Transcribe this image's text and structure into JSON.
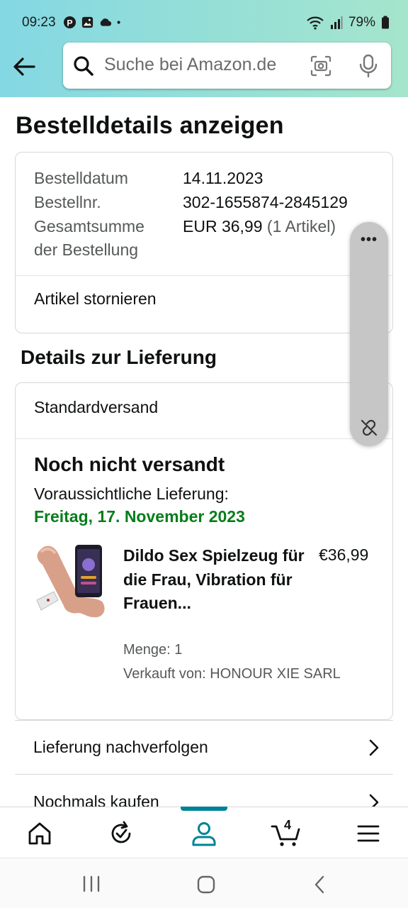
{
  "status_bar": {
    "time": "09:23",
    "battery": "79%"
  },
  "search": {
    "placeholder": "Suche bei Amazon.de"
  },
  "page_title": "Bestelldetails anzeigen",
  "order": {
    "date_label": "Bestelldatum",
    "date_value": "14.11.2023",
    "number_label": "Bestellnr.",
    "number_value": "302-1655874-2845129",
    "total_label_1": "Gesamtsumme",
    "total_label_2": "der Bestellung",
    "total_value": "EUR 36,99",
    "total_items": "(1 Artikel)",
    "cancel_label": "Artikel stornieren"
  },
  "delivery": {
    "section_title": "Details zur Lieferung",
    "method": "Standardversand",
    "status": "Noch nicht versandt",
    "estimate_label": "Voraussichtliche Lieferung:",
    "estimate_date": "Freitag, 17. November 2023",
    "item": {
      "title": "Dildo Sex Spielzeug für die Frau, Vibration für Frauen...",
      "price": "€36,99",
      "quantity": "Menge: 1",
      "seller": "Verkauft von: HONOUR XIE SARL"
    }
  },
  "actions": [
    {
      "label": "Lieferung nachverfolgen"
    },
    {
      "label": "Nochmals kaufen"
    }
  ],
  "bottom_nav": {
    "cart_count": "4",
    "active": "account"
  },
  "colors": {
    "accent": "#008296",
    "delivery_green": "#067d1b",
    "header_start": "#84d8e3",
    "header_end": "#a5e5cc"
  }
}
